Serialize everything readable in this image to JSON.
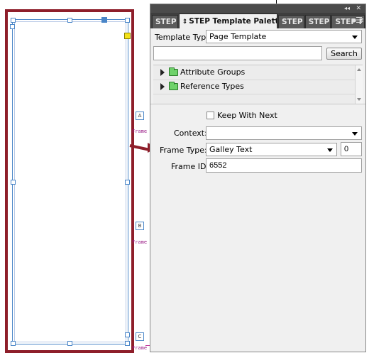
{
  "palette": {
    "tabs": [
      {
        "label": "STEP",
        "active": false
      },
      {
        "label": "STEP Template Palette",
        "active": true
      },
      {
        "label": "STEP",
        "active": false
      },
      {
        "label": "STEP",
        "active": false
      },
      {
        "label": "STEP F",
        "active": false
      }
    ],
    "collapse_icon": "double-chevron-left-icon",
    "close_icon": "close-icon",
    "menu_icon": "panel-menu-icon",
    "template_type_label": "Template Type",
    "template_type_value": "Page Template",
    "search_value": "",
    "search_button": "Search",
    "tree": [
      {
        "label": "Attribute Groups"
      },
      {
        "label": "Reference Types"
      }
    ],
    "keep_with_next_label": "Keep With Next",
    "keep_with_next_checked": false,
    "context_label": "Context:",
    "context_value": "",
    "frame_type_label": "Frame Type:",
    "frame_type_value": "Galley Text",
    "frame_type_number": "0",
    "frame_id_label": "Frame ID",
    "frame_id_value": "6552"
  },
  "canvas": {
    "link_marks": [
      "Frame",
      "Frame",
      "Frame"
    ],
    "tag_marks": [
      "A",
      "B",
      "C"
    ]
  },
  "colors": {
    "highlight": "#8e1e2a",
    "frame": "#4a86c8",
    "panel_bg": "#f0f0f0",
    "tab_bar": "#3e3e3e"
  }
}
